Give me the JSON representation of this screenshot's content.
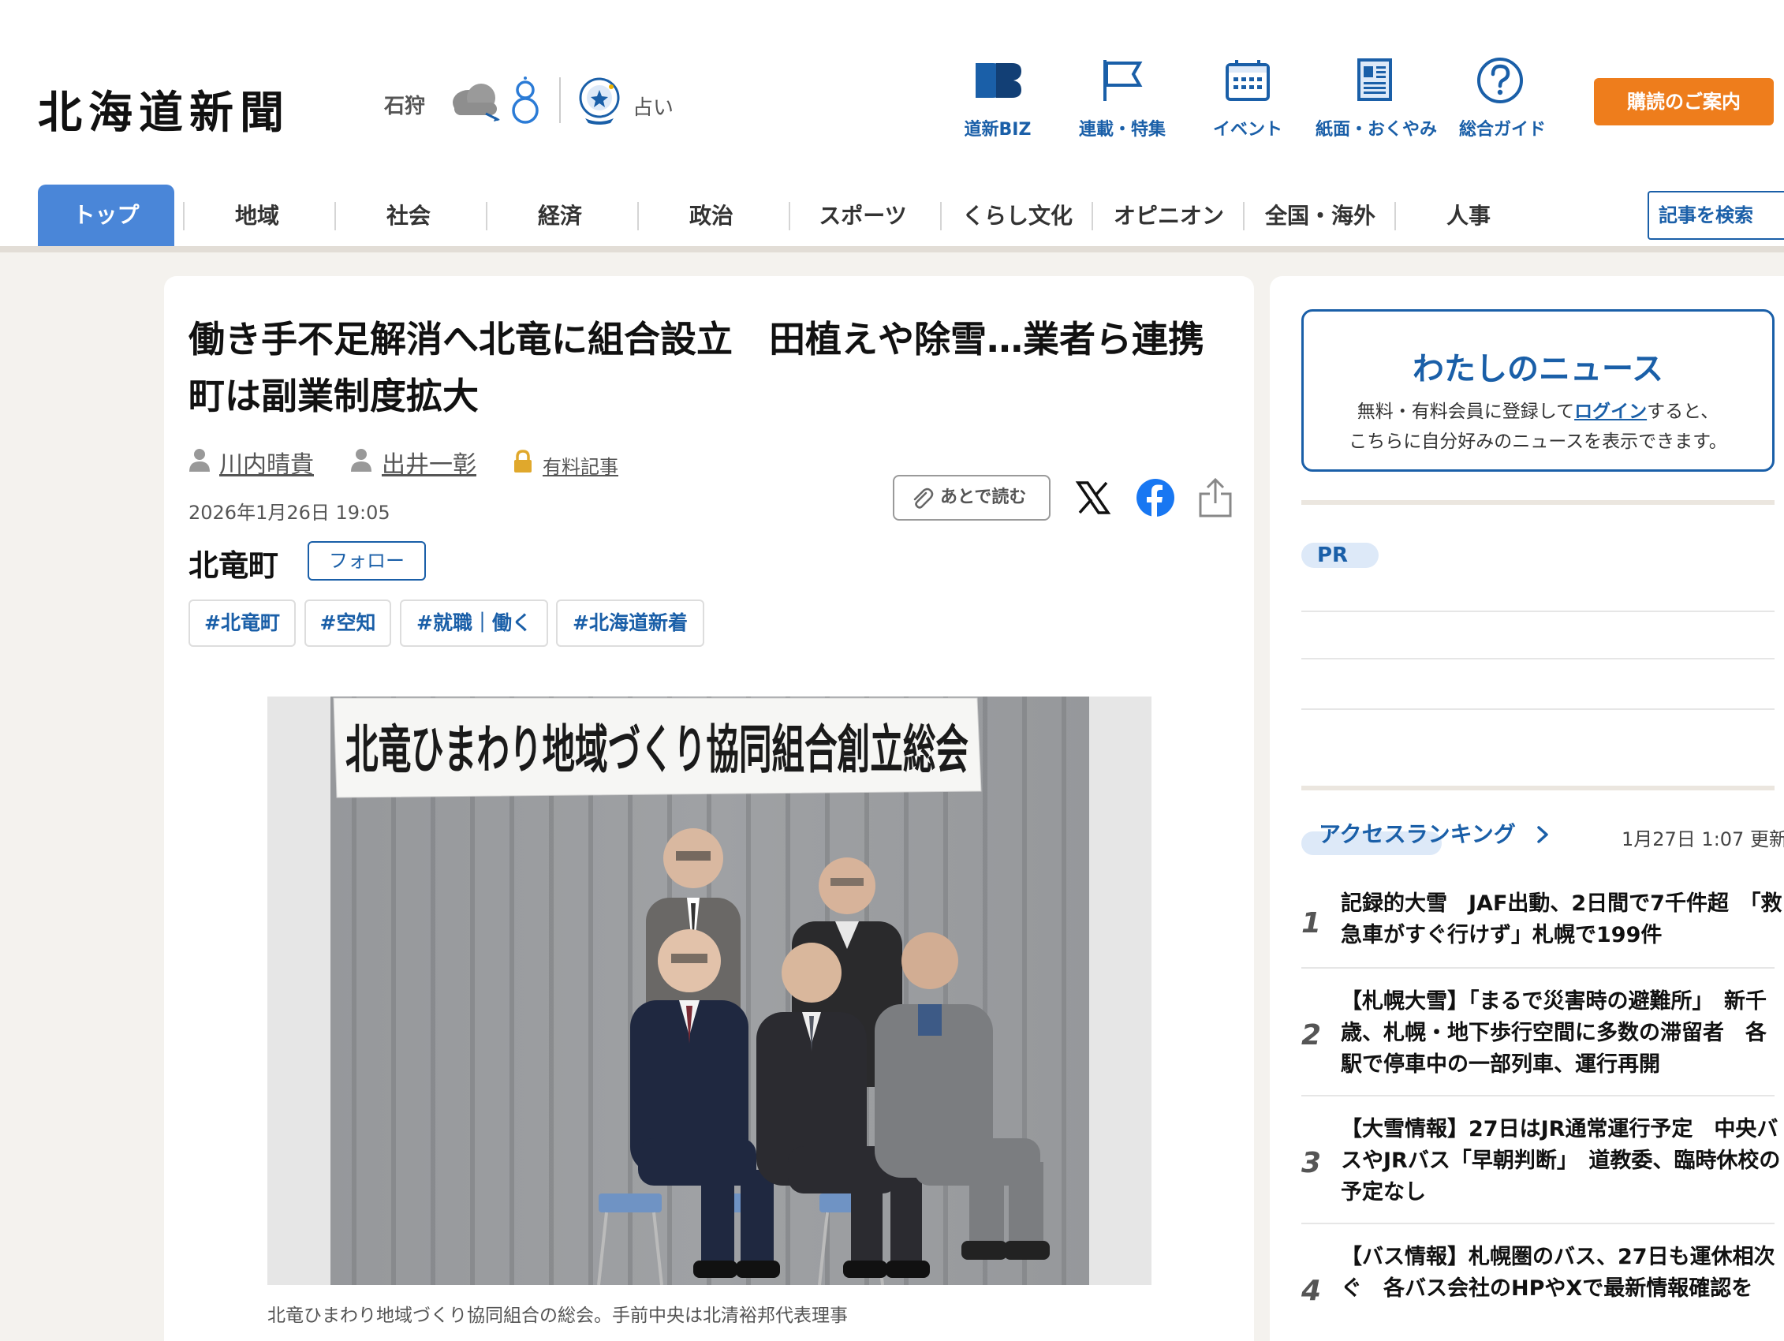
{
  "header": {
    "logo": "北海道新聞",
    "weather_location": "石狩",
    "fortune_label": "占い",
    "nav": [
      {
        "label": "道新BIZ",
        "icon": "db-biz-icon"
      },
      {
        "label": "連載・特集",
        "icon": "flag-icon"
      },
      {
        "label": "イベント",
        "icon": "calendar-icon"
      },
      {
        "label": "紙面・おくやみ",
        "icon": "newspaper-icon"
      },
      {
        "label": "総合ガイド",
        "icon": "question-icon"
      }
    ],
    "subscribe_label": "購読のご案内"
  },
  "main_nav": {
    "items": [
      "トップ",
      "地域",
      "社会",
      "経済",
      "政治",
      "スポーツ",
      "くらし文化",
      "オピニオン",
      "全国・海外",
      "人事"
    ],
    "active_index": 0,
    "search_label": "記事を検索"
  },
  "article": {
    "headline": "働き手不足解消へ北竜に組合設立　田植えや除雪…業者ら連携　町は副業制度拡大",
    "authors": [
      "川内晴貴",
      "出井一彰"
    ],
    "paid_label": "有料記事",
    "date": "2026年1月26日 19:05",
    "read_later_label": "あとで読む",
    "town": "北竜町",
    "follow_label": "フォロー",
    "tags": [
      "#北竜町",
      "#空知",
      "#就職｜働く",
      "#北海道新着"
    ],
    "photo_banner": "北竜ひまわり地域づくり協同組合創立総会",
    "caption": "北竜ひまわり地域づくり協同組合の総会。手前中央は北清裕邦代表理事"
  },
  "sidebar": {
    "mynews": {
      "title": "わたしのニュース",
      "line1_before": "無料・有料会員に登録して",
      "login": "ログイン",
      "line1_after": "すると、",
      "line2": "こちらに自分好みのニュースを表示できます。"
    },
    "pr_label": "PR",
    "ranking": {
      "title": "アクセスランキング",
      "updated": "1月27日 1:07 更新",
      "items": [
        {
          "rank": "1",
          "title": "記録的大雪　JAF出動、2日間で7千件超　「救急車がすぐ行けず」札幌で199件"
        },
        {
          "rank": "2",
          "title": "【札幌大雪】「まるで災害時の避難所」　新千歳、札幌・地下歩行空間に多数の滞留者　各駅で停車中の一部列車、運行再開"
        },
        {
          "rank": "3",
          "title": "【大雪情報】27日はJR通常運行予定　中央バスやJRバス「早朝判断」　道教委、臨時休校の予定なし"
        },
        {
          "rank": "4",
          "title": "【バス情報】札幌圏のバス、27日も運休相次ぐ　各バス会社のHPやXで最新情報確認を"
        }
      ]
    }
  }
}
